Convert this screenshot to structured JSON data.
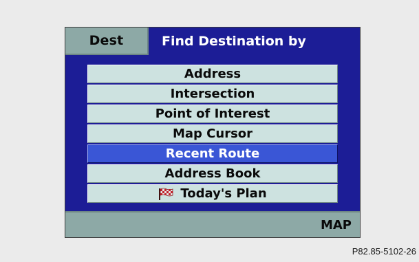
{
  "header": {
    "tab_label": "Dest",
    "title": "Find Destination by"
  },
  "menu": {
    "items": [
      {
        "label": "Address",
        "selected": false
      },
      {
        "label": "Intersection",
        "selected": false
      },
      {
        "label": "Point of Interest",
        "selected": false
      },
      {
        "label": "Map Cursor",
        "selected": false
      },
      {
        "label": "Recent Route",
        "selected": true
      },
      {
        "label": "Address Book",
        "selected": false
      },
      {
        "label": "Today's Plan",
        "selected": false,
        "icon": "checkered-flag-icon"
      }
    ]
  },
  "footer": {
    "map_label": "MAP"
  },
  "caption": "P82.85-5102-26",
  "colors": {
    "screen_bg": "#1c1d96",
    "tab_bg": "#8da9a6",
    "item_bg": "#cde2e0",
    "selected_bg": "#3a56d6",
    "page_bg": "#ebebeb"
  }
}
